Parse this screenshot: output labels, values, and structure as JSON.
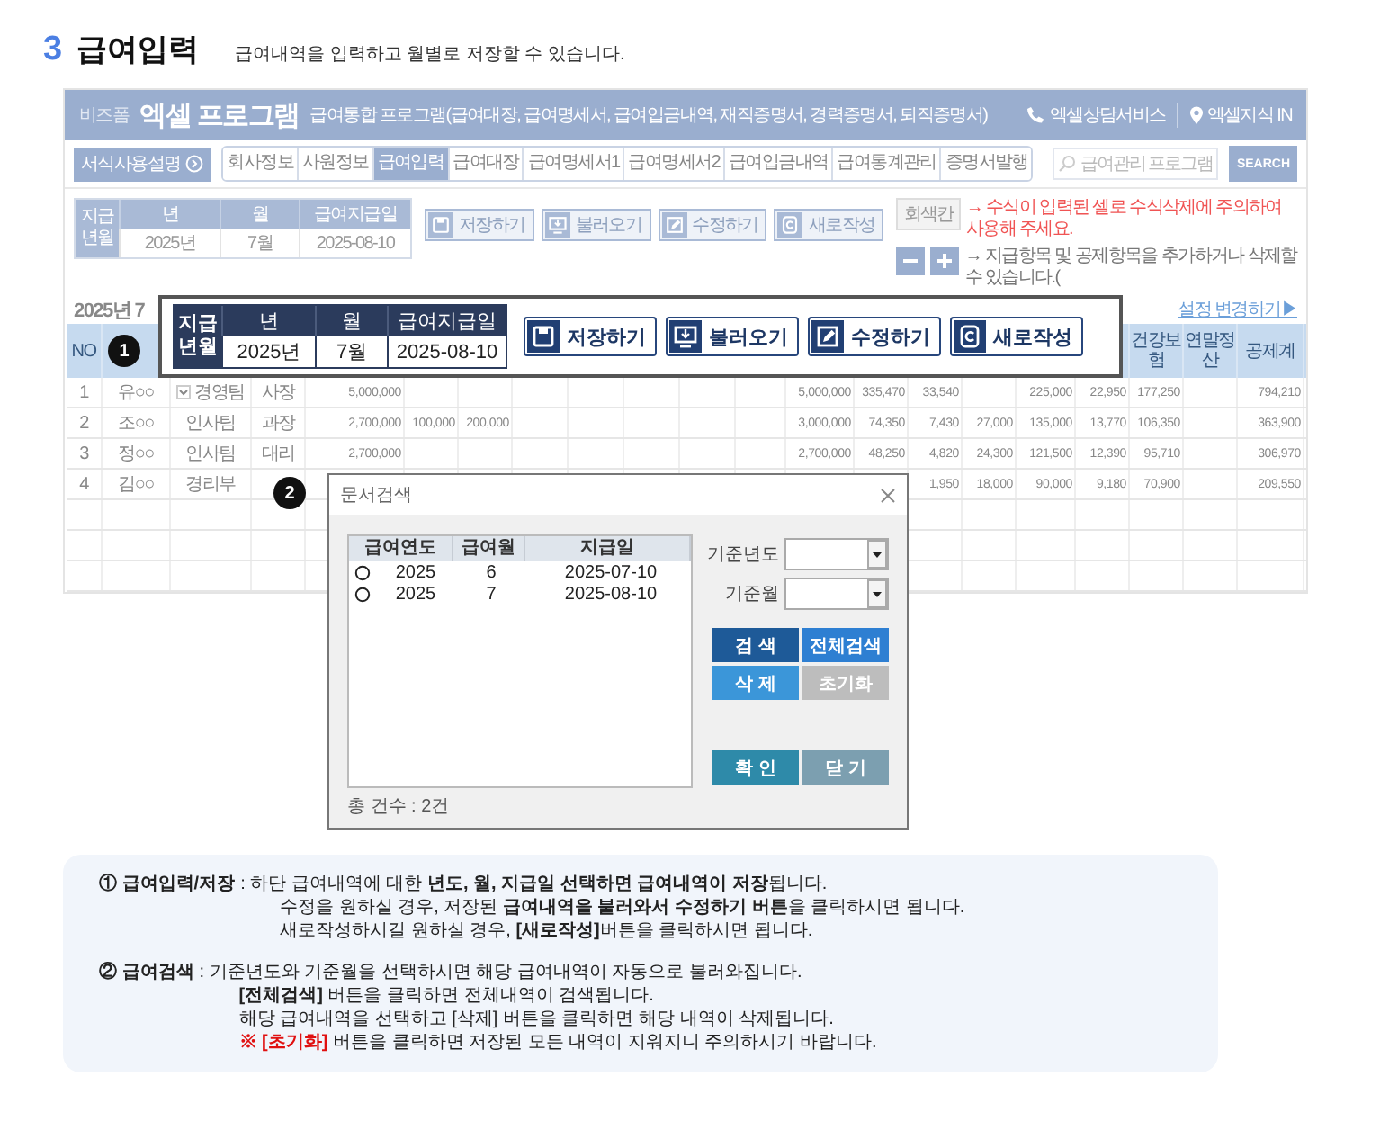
{
  "heading": {
    "number": "3",
    "title": "급여입력",
    "description": "급여내역을 입력하고 월별로 저장할 수 있습니다."
  },
  "app": {
    "brand": "비즈폼",
    "name": "엑셀 프로그램",
    "subtitle": "급여통합 프로그램(급여대장, 급여명세서, 급여입금내역, 재직증명서, 경력증명서, 퇴직증명서)",
    "header_links": [
      {
        "kind": "phone",
        "label": "엑셀상담서비스"
      },
      {
        "kind": "pin",
        "label": "엑셀지식 IN"
      }
    ],
    "guide_button": "서식사용설명",
    "tabs": [
      {
        "label": "회사정보",
        "selected": false
      },
      {
        "label": "사원정보",
        "selected": false
      },
      {
        "label": "급여입력",
        "selected": true
      },
      {
        "label": "급여대장",
        "selected": false
      },
      {
        "label": "급여명세서1",
        "selected": false
      },
      {
        "label": "급여명세서2",
        "selected": false
      },
      {
        "label": "급여입금내역",
        "selected": false
      },
      {
        "label": "급여통계관리",
        "selected": false
      },
      {
        "label": "증명서발행",
        "selected": false
      }
    ],
    "search": {
      "placeholder": "급여관리 프로그램",
      "button": "SEARCH"
    },
    "period": {
      "label": "지급년월",
      "columns": [
        "년",
        "월",
        "급여지급일"
      ],
      "values": [
        "2025년",
        "7월",
        "2025-08-10"
      ]
    },
    "actions": [
      {
        "kind": "save",
        "label": "저장하기"
      },
      {
        "kind": "load",
        "label": "불러오기"
      },
      {
        "kind": "edit",
        "label": "수정하기"
      },
      {
        "kind": "new",
        "label": "새로작성"
      }
    ],
    "legend": [
      {
        "kind": "formula",
        "swatch": "회색칸",
        "text": "→ 수식이 입력된 셀로 수식삭제에 주의하여 사용해 주세요."
      },
      {
        "kind": "rows",
        "text": "→ 지급항목 및 공제항목을 추가하거나 삭제할 수 있습니다.("
      }
    ],
    "sheet_title": "2025년 7",
    "settings_link": "설정 변경하기▶",
    "table": {
      "columns": [
        "NO",
        null,
        null,
        null,
        null,
        null,
        null,
        null,
        null,
        null,
        null,
        null,
        null,
        null,
        null,
        null,
        null,
        null,
        "건강보험",
        "연말정산",
        "공제계"
      ],
      "rows": [
        {
          "dropdown": true,
          "cells": [
            "1",
            "유○○",
            "경영팀",
            "사장",
            "5,000,000",
            null,
            null,
            null,
            null,
            null,
            null,
            null,
            "5,000,000",
            "335,470",
            "33,540",
            null,
            "225,000",
            "22,950",
            "177,250",
            null,
            "794,210"
          ]
        },
        {
          "dropdown": false,
          "cells": [
            "2",
            "조○○",
            "인사팀",
            "과장",
            "2,700,000",
            "100,000",
            "200,000",
            null,
            null,
            null,
            null,
            null,
            "3,000,000",
            "74,350",
            "7,430",
            "27,000",
            "135,000",
            "13,770",
            "106,350",
            null,
            "363,900"
          ]
        },
        {
          "dropdown": false,
          "cells": [
            "3",
            "정○○",
            "인사팀",
            "대리",
            "2,700,000",
            null,
            null,
            null,
            null,
            null,
            null,
            null,
            "2,700,000",
            "48,250",
            "4,820",
            "24,300",
            "121,500",
            "12,390",
            "95,710",
            null,
            "306,970"
          ]
        },
        {
          "dropdown": false,
          "cells": [
            "4",
            "김○○",
            "경리부",
            null,
            null,
            null,
            null,
            null,
            null,
            null,
            null,
            null,
            null,
            null,
            "1,950",
            "18,000",
            "90,000",
            "9,180",
            "70,900",
            null,
            "209,550"
          ]
        }
      ]
    }
  },
  "callout": {
    "badge": "1",
    "period": {
      "label": "지급년월",
      "columns": [
        "년",
        "월",
        "급여지급일"
      ],
      "values": [
        "2025년",
        "7월",
        "2025-08-10"
      ]
    },
    "actions": [
      {
        "kind": "save",
        "label": "저장하기"
      },
      {
        "kind": "load",
        "label": "불러오기"
      },
      {
        "kind": "edit",
        "label": "수정하기"
      },
      {
        "kind": "new",
        "label": "새로작성"
      }
    ]
  },
  "dialog": {
    "badge": "2",
    "title": "문서검색",
    "list": {
      "columns": [
        "급여연도",
        "급여월",
        "지급일"
      ],
      "rows": [
        {
          "selected": false,
          "cells": [
            "2025",
            "6",
            "2025-07-10"
          ]
        },
        {
          "selected": false,
          "cells": [
            "2025",
            "7",
            "2025-08-10"
          ]
        }
      ]
    },
    "filters": [
      {
        "label": "기준년도"
      },
      {
        "label": "기준월"
      }
    ],
    "buttons": [
      {
        "kind": "search",
        "label": "검 색"
      },
      {
        "kind": "search_all",
        "label": "전체검색"
      },
      {
        "kind": "delete",
        "label": "삭 제"
      },
      {
        "kind": "reset",
        "label": "초기화"
      },
      {
        "kind": "ok",
        "label": "확 인"
      },
      {
        "kind": "close",
        "label": "닫 기"
      }
    ],
    "count": "총 건수 : 2건"
  },
  "notes": [
    {
      "label": "① 급여입력/저장",
      "lines": [
        {
          "text": ": 하단 급여내역에 대한 **년도, 월, 지급일 선택하면 급여내역이 저장**됩니다."
        },
        {
          "text": "수정을 원하실 경우, 저장된 **급여내역을 불러와서 수정하기 버튼**을 클릭하시면 됩니다."
        },
        {
          "text": "새로작성하시길 원하실 경우, **[새로작성]**버튼을 클릭하시면 됩니다."
        }
      ]
    },
    {
      "label": "② 급여검색",
      "lines": [
        {
          "text": ": 기준년도와 기준월을 선택하시면 해당 급여내역이 자동으로 불러와집니다."
        },
        {
          "text": "**[전체검색]** 버튼을 클릭하면 전체내역이 검색됩니다."
        },
        {
          "text": "해당 급여내역을 선택하고 [삭제] 버튼을 클릭하면 해당 내역이 삭제됩니다."
        },
        {
          "warning": "※ [초기화]",
          "text": "버튼을 클릭하면 저장된 모든 내역이 지워지니 주의하시기 바랍니다."
        }
      ]
    }
  ]
}
